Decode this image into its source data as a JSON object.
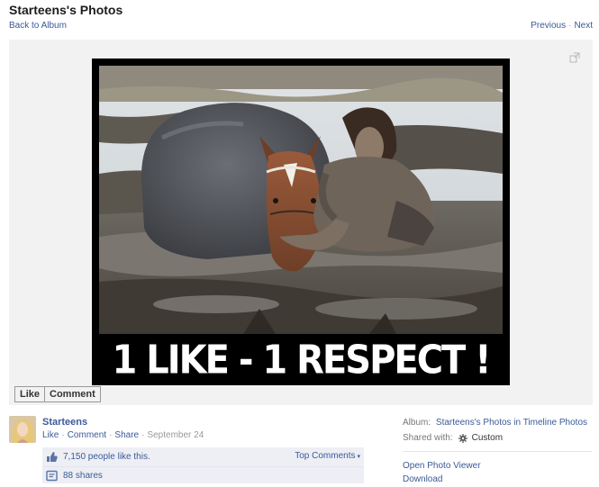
{
  "header": {
    "title": "Starteens's Photos",
    "back_label": "Back to Album",
    "previous_label": "Previous",
    "next_label": "Next",
    "separator": "·"
  },
  "photo": {
    "caption": "1 LIKE - 1 RESPECT !",
    "description_icon": "expand-icon"
  },
  "like_bar": {
    "like_label": "Like",
    "comment_label": "Comment"
  },
  "owner": {
    "name": "Starteens",
    "like_label": "Like",
    "comment_label": "Comment",
    "share_label": "Share",
    "date": "September 24"
  },
  "ufi": {
    "likes_text": "7,150 people like this.",
    "shares_text": "88 shares",
    "top_comments_label": "Top Comments"
  },
  "meta": {
    "album_prefix": "Album:",
    "album_name": "Starteens's Photos in Timeline Photos",
    "shared_prefix": "Shared with:",
    "shared_value": "Custom",
    "open_viewer_label": "Open Photo Viewer",
    "download_label": "Download"
  },
  "colors": {
    "link": "#3b5998",
    "stage_bg": "#f2f2f2",
    "ufi_bg": "#edeff4"
  }
}
